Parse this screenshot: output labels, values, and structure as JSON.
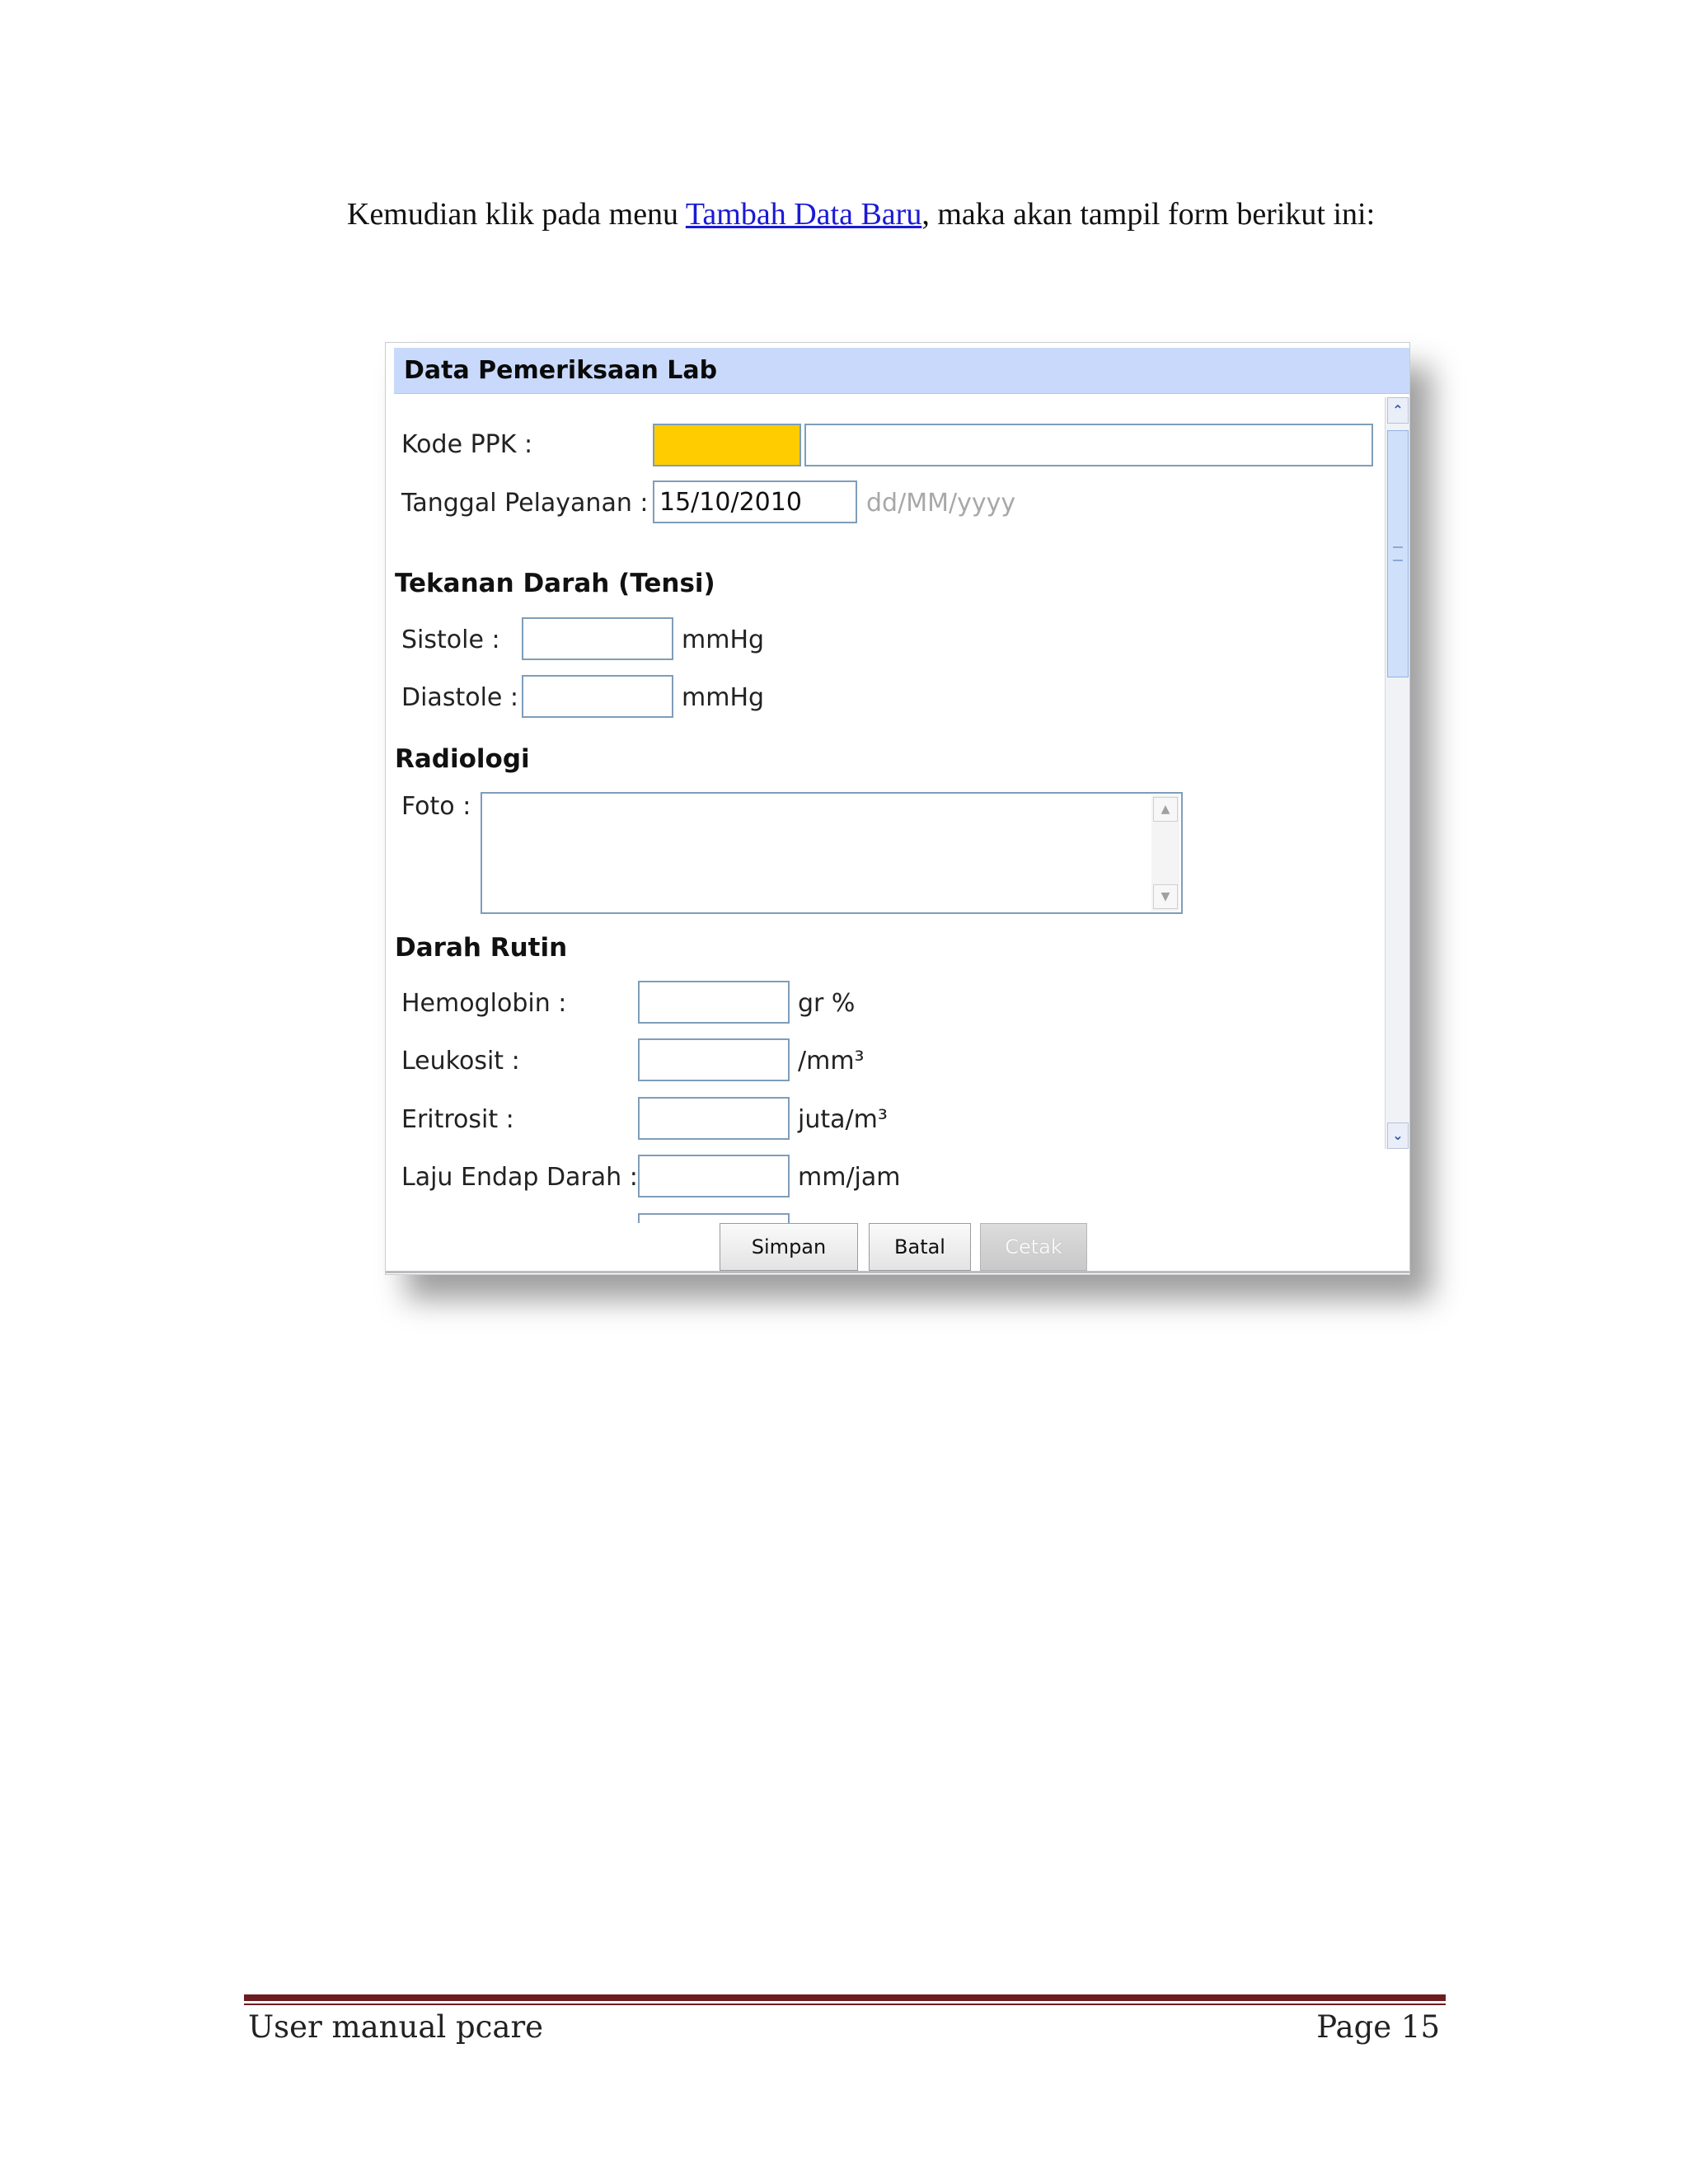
{
  "intro": {
    "before": "Kemudian klik pada menu ",
    "link": "Tambah Data Baru",
    "after": ", maka akan tampil form berikut ini:"
  },
  "form": {
    "title": "Data Pemeriksaan Lab",
    "kode_ppk_label": "Kode PPK :",
    "kode_ppk_code": "",
    "kode_ppk_name": "",
    "tanggal_label": "Tanggal Pelayanan :",
    "tanggal_value": "15/10/2010",
    "tanggal_hint": "dd/MM/yyyy",
    "tensi_heading": "Tekanan Darah (Tensi)",
    "sistole_label": "Sistole :",
    "sistole_value": "",
    "sistole_unit": "mmHg",
    "diastole_label": "Diastole :",
    "diastole_value": "",
    "diastole_unit": "mmHg",
    "radiologi_heading": "Radiologi",
    "foto_label": "Foto :",
    "foto_value": "",
    "darah_heading": "Darah Rutin",
    "hemoglobin_label": "Hemoglobin :",
    "hemoglobin_value": "",
    "hemoglobin_unit": "gr %",
    "leukosit_label": "Leukosit :",
    "leukosit_value": "",
    "leukosit_unit": "/mm³",
    "eritrosit_label": "Eritrosit :",
    "eritrosit_value": "",
    "eritrosit_unit": "juta/m³",
    "led_label": "Laju Endap Darah :",
    "led_value": "",
    "led_unit": "mm/jam"
  },
  "buttons": {
    "simpan": "Simpan",
    "batal": "Batal",
    "cetak": "Cetak"
  },
  "colors": {
    "title_bar": "#c9d9fb",
    "required_field": "#ffcc00",
    "link": "#1a1ad6",
    "footer_rule": "#6b1c20"
  },
  "footer": {
    "left": "User manual pcare",
    "right": "Page 15"
  }
}
